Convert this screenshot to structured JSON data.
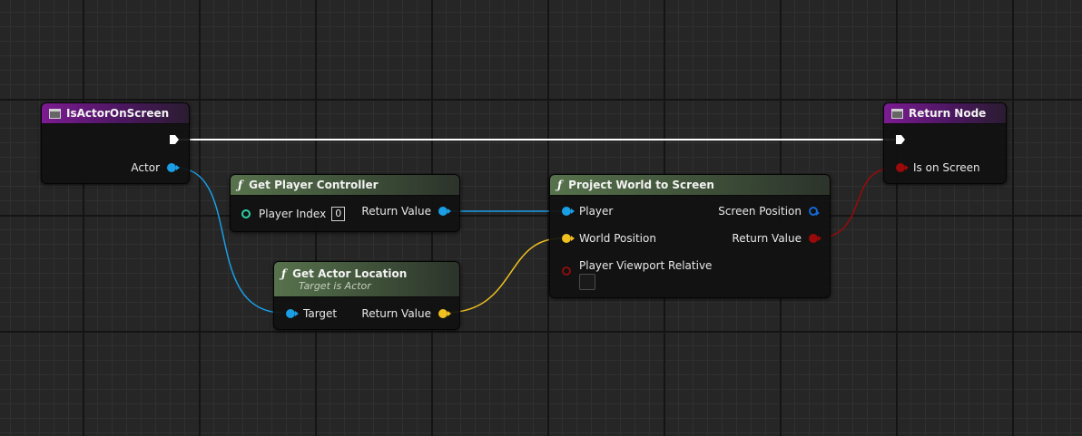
{
  "colors": {
    "exec": "#ffffff",
    "object_pin": "#1a9ee5",
    "vector_pin": "#f0c020",
    "bool_pin": "#9a0a0a",
    "struct_pin": "#1568d6",
    "int_pin": "#2ed1a4"
  },
  "nodes": {
    "entry": {
      "title": "IsActorOnScreen",
      "out_actor": "Actor",
      "icon": "event-icon"
    },
    "return_node": {
      "title": "Return Node",
      "in_bool": "Is on Screen",
      "icon": "event-icon"
    },
    "get_player_controller": {
      "title": "Get Player Controller",
      "in_label": "Player Index",
      "in_value": "0",
      "out_label": "Return Value",
      "icon": "function-icon"
    },
    "get_actor_location": {
      "title": "Get Actor Location",
      "subtitle": "Target is Actor",
      "in_label": "Target",
      "out_label": "Return Value",
      "icon": "function-icon"
    },
    "project_world_to_screen": {
      "title": "Project World to Screen",
      "in_player": "Player",
      "in_world": "World Position",
      "in_viewport": "Player Viewport Relative",
      "out_screen": "Screen Position",
      "out_return": "Return Value",
      "icon": "function-icon"
    }
  }
}
